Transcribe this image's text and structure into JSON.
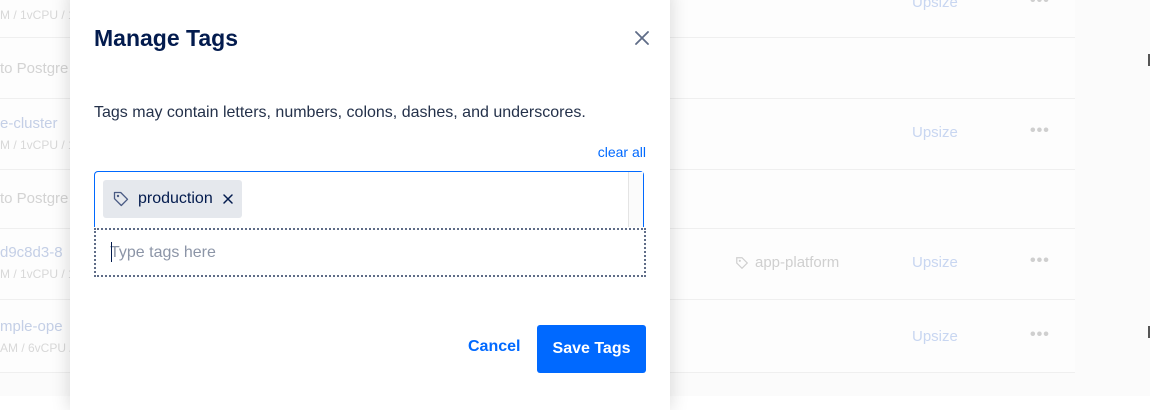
{
  "background": {
    "rows": [
      {
        "name": "",
        "sub": "M / 1vCPU / 1",
        "upsize": "Upsize",
        "more": "•••"
      },
      {
        "name": "to Postgre",
        "sub": "",
        "upsize": "",
        "more": ""
      },
      {
        "name": "e-cluster",
        "sub": "M / 1vCPU / 1",
        "upsize": "Upsize",
        "more": "•••"
      },
      {
        "name": "to Postgre",
        "sub": "",
        "upsize": "",
        "more": ""
      },
      {
        "name": "d9c8d3-8",
        "sub": "M / 1vCPU / 1",
        "upsize": "Upsize",
        "more": "•••",
        "tag": "app-platform"
      },
      {
        "name": "mple-ope",
        "sub": "AM / 6vCPU /",
        "upsize": "Upsize",
        "more": "•••"
      }
    ]
  },
  "modal": {
    "title": "Manage Tags",
    "close_icon": "close-icon",
    "helper_text": "Tags may contain letters, numbers, colons, dashes, and underscores.",
    "clear_all_label": "clear all",
    "tags": [
      {
        "label": "production",
        "icon": "tag-icon",
        "remove_icon": "close-icon"
      }
    ],
    "input": {
      "value": "",
      "placeholder": "Type tags here"
    },
    "cancel_label": "Cancel",
    "save_label": "Save Tags"
  },
  "colors": {
    "accent": "#0069ff",
    "title": "#031b4e",
    "chip_bg": "#e5e8ed"
  }
}
